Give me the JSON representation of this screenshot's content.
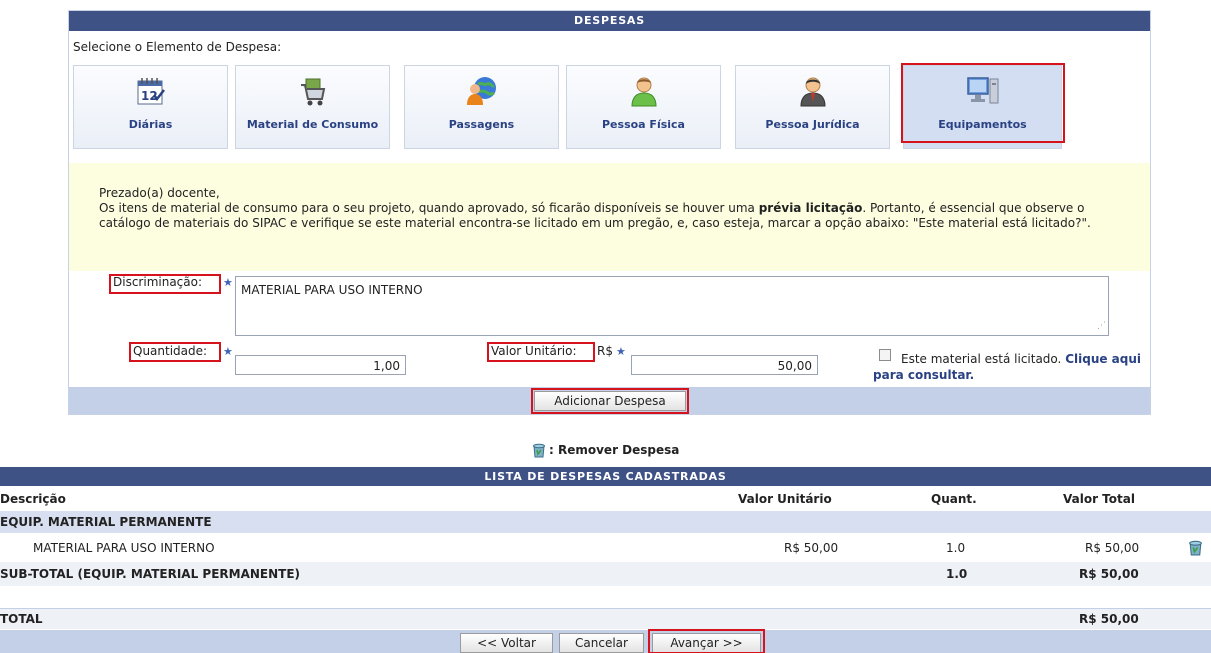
{
  "panel": {
    "title": "DESPESAS",
    "select_label": "Selecione o Elemento de Despesa:",
    "tiles": [
      {
        "label": "Diárias",
        "icon": "calendar-icon"
      },
      {
        "label": "Material de Consumo",
        "icon": "shopping-cart-icon"
      },
      {
        "label": "Passagens",
        "icon": "globe-person-icon"
      },
      {
        "label": "Pessoa Física",
        "icon": "person-icon"
      },
      {
        "label": "Pessoa Jurídica",
        "icon": "business-person-icon"
      },
      {
        "label": "Equipamentos",
        "icon": "computer-icon"
      }
    ],
    "selected_tile": "Equipamentos"
  },
  "notice": {
    "greeting": "Prezado(a) docente,",
    "part1": "Os itens de material de consumo para o seu projeto, quando aprovado, só ficarão disponíveis se houver uma ",
    "bold": "prévia licitação",
    "part2": ". Portanto, é essencial que observe o catálogo de materiais do SIPAC e verifique se este material encontra-se licitado em um pregão, e, caso esteja, marcar a opção abaixo: \"Este material está licitado?\"."
  },
  "form": {
    "discriminacao_label": "Discriminação:",
    "discriminacao_value": "MATERIAL PARA USO INTERNO",
    "quantidade_label": "Quantidade:",
    "quantidade_value": "1,00",
    "valor_unitario_label": "Valor Unitário:",
    "currency": "R$",
    "valor_unitario_value": "50,00",
    "licitado_text": "Este material está licitado.",
    "licitado_link": "Clique aqui para consultar.",
    "licitado_checked": false,
    "add_button": "Adicionar Despesa"
  },
  "legend": {
    "text": ": Remover Despesa",
    "icon": "trash-icon"
  },
  "list": {
    "title": "LISTA DE DESPESAS CADASTRADAS",
    "headers": {
      "descricao": "Descrição",
      "valor_unitario": "Valor Unitário",
      "quant": "Quant.",
      "valor_total": "Valor Total"
    },
    "group": "EQUIP. MATERIAL PERMANENTE",
    "item": {
      "descricao": "MATERIAL PARA USO INTERNO",
      "valor_unitario": "R$ 50,00",
      "quant": "1.0",
      "valor_total": "R$ 50,00"
    },
    "subtotal": {
      "label": "SUB-TOTAL (EQUIP. MATERIAL PERMANENTE)",
      "quant": "1.0",
      "valor_total": "R$ 50,00"
    },
    "total": {
      "label": "TOTAL",
      "valor_total": "R$ 50,00"
    }
  },
  "nav": {
    "back": "<< Voltar",
    "cancel": "Cancelar",
    "next": "Avançar >>"
  },
  "colors": {
    "caption_bar": "#3f5286",
    "link": "#2a4283",
    "highlight": "#d6121c",
    "notice_bg": "#fdfde0",
    "footer_bg": "#c4cfe8"
  }
}
